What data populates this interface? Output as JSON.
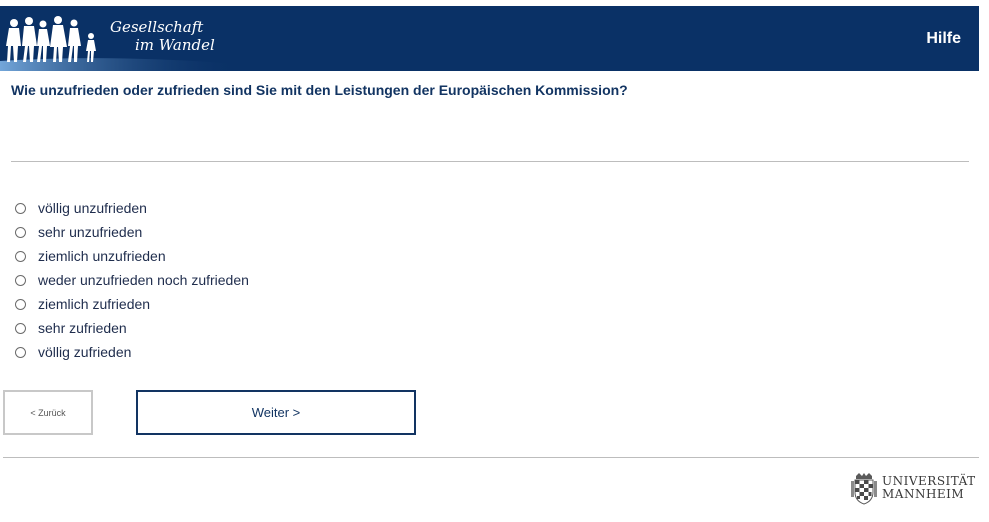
{
  "header": {
    "logo_line1": "Gesellschaft",
    "logo_line2": "im Wandel",
    "help_label": "Hilfe",
    "background_color": "#0a3166"
  },
  "question": {
    "text": "Wie unzufrieden oder zufrieden sind Sie mit den Leistungen der Europäischen Kommission?",
    "options": [
      {
        "label": "völlig unzufrieden",
        "selected": false
      },
      {
        "label": "sehr unzufrieden",
        "selected": false
      },
      {
        "label": "ziemlich unzufrieden",
        "selected": false
      },
      {
        "label": "weder unzufrieden noch zufrieden",
        "selected": false
      },
      {
        "label": "ziemlich zufrieden",
        "selected": false
      },
      {
        "label": "sehr zufrieden",
        "selected": false
      },
      {
        "label": "völlig zufrieden",
        "selected": false
      }
    ]
  },
  "navigation": {
    "back_label": "< Zurück",
    "next_label": "Weiter >"
  },
  "footer": {
    "university_line1": "UNIVERSITÄT",
    "university_line2": "MANNHEIM",
    "crest_icon": "university-crest-icon"
  }
}
